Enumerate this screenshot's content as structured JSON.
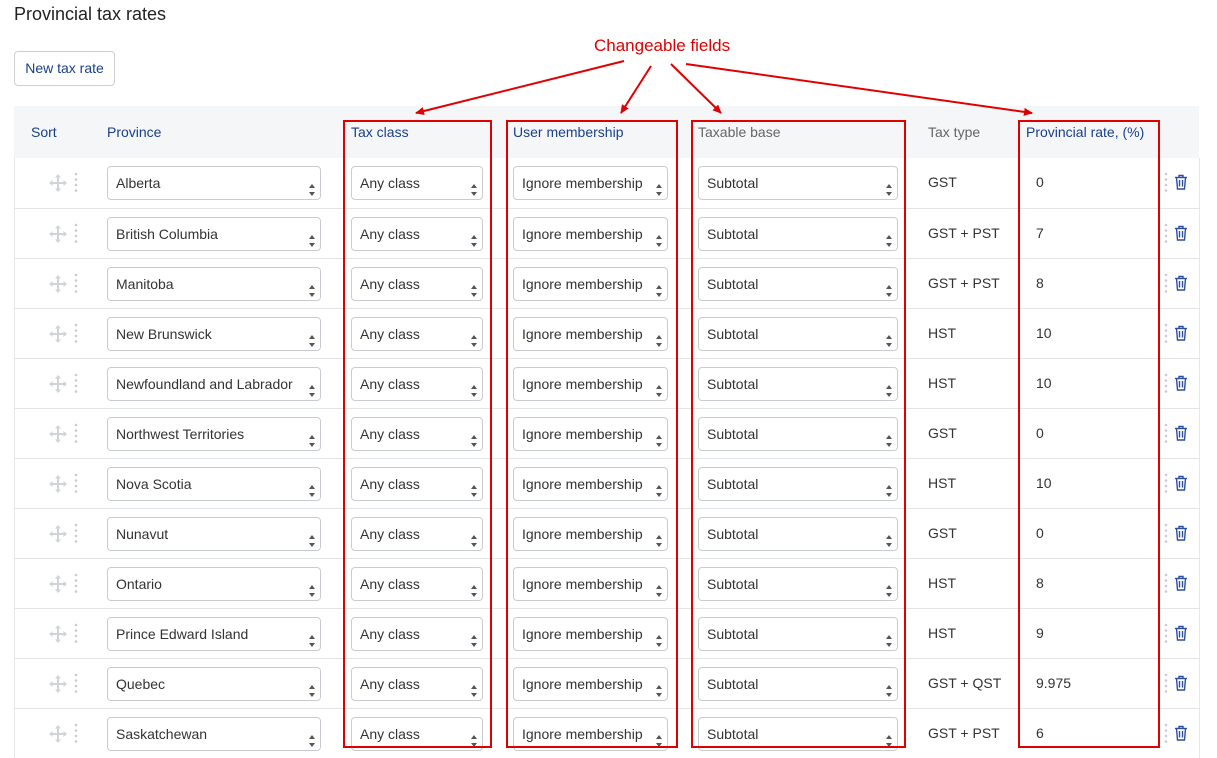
{
  "page": {
    "title": "Provincial tax rates"
  },
  "toolbar": {
    "new_label": "New tax rate"
  },
  "annotation": {
    "label": "Changeable fields",
    "color": "#e00000"
  },
  "columns": {
    "sort": "Sort",
    "province": "Province",
    "tax_class": "Tax class",
    "membership": "User membership",
    "taxable_base": "Taxable base",
    "tax_type": "Tax type",
    "rate": "Provincial rate, (%)"
  },
  "icons": {
    "drag": "drag-move-icon",
    "menu": "vertical-dots-icon",
    "delete": "trash-icon",
    "select": "select-arrows-icon"
  },
  "colors": {
    "link": "#1a3f8a",
    "header_bg": "#f5f6f8",
    "delete": "#2b4fa1"
  },
  "rows": [
    {
      "province": "Alberta",
      "tax_class": "Any class",
      "membership": "Ignore membership",
      "base": "Subtotal",
      "tax_type": "GST",
      "rate": "0"
    },
    {
      "province": "British Columbia",
      "tax_class": "Any class",
      "membership": "Ignore membership",
      "base": "Subtotal",
      "tax_type": "GST + PST",
      "rate": "7"
    },
    {
      "province": "Manitoba",
      "tax_class": "Any class",
      "membership": "Ignore membership",
      "base": "Subtotal",
      "tax_type": "GST + PST",
      "rate": "8"
    },
    {
      "province": "New Brunswick",
      "tax_class": "Any class",
      "membership": "Ignore membership",
      "base": "Subtotal",
      "tax_type": "HST",
      "rate": "10"
    },
    {
      "province": "Newfoundland and Labrador",
      "tax_class": "Any class",
      "membership": "Ignore membership",
      "base": "Subtotal",
      "tax_type": "HST",
      "rate": "10"
    },
    {
      "province": "Northwest Territories",
      "tax_class": "Any class",
      "membership": "Ignore membership",
      "base": "Subtotal",
      "tax_type": "GST",
      "rate": "0"
    },
    {
      "province": "Nova Scotia",
      "tax_class": "Any class",
      "membership": "Ignore membership",
      "base": "Subtotal",
      "tax_type": "HST",
      "rate": "10"
    },
    {
      "province": "Nunavut",
      "tax_class": "Any class",
      "membership": "Ignore membership",
      "base": "Subtotal",
      "tax_type": "GST",
      "rate": "0"
    },
    {
      "province": "Ontario",
      "tax_class": "Any class",
      "membership": "Ignore membership",
      "base": "Subtotal",
      "tax_type": "HST",
      "rate": "8"
    },
    {
      "province": "Prince Edward Island",
      "tax_class": "Any class",
      "membership": "Ignore membership",
      "base": "Subtotal",
      "tax_type": "HST",
      "rate": "9"
    },
    {
      "province": "Quebec",
      "tax_class": "Any class",
      "membership": "Ignore membership",
      "base": "Subtotal",
      "tax_type": "GST + QST",
      "rate": "9.975"
    },
    {
      "province": "Saskatchewan",
      "tax_class": "Any class",
      "membership": "Ignore membership",
      "base": "Subtotal",
      "tax_type": "GST + PST",
      "rate": "6"
    }
  ]
}
